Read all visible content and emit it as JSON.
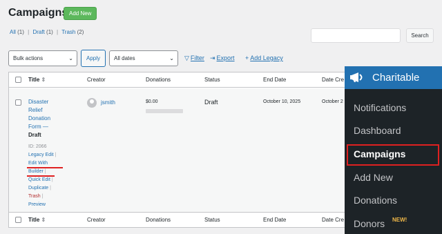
{
  "header": {
    "title": "Campaigns",
    "add_new": "Add New"
  },
  "filters": {
    "all": "All",
    "all_count": "(1)",
    "draft": "Draft",
    "draft_count": "(1)",
    "trash": "Trash",
    "trash_count": "(2)",
    "separator": "|"
  },
  "search": {
    "placeholder": "",
    "button": "Search"
  },
  "toolbar": {
    "bulk_actions": "Bulk actions",
    "apply": "Apply",
    "all_dates": "All dates",
    "filter": "Filter",
    "export": "Export",
    "add_legacy": "Add Legacy"
  },
  "table": {
    "columns": [
      "Title",
      "Creator",
      "Donations",
      "Status",
      "End Date",
      "Date Cre"
    ],
    "row": {
      "title": "Disaster Relief Donation Form",
      "title_suffix": " — ",
      "state": "Draft",
      "id": "ID: 2066",
      "actions": [
        "Legacy Edit",
        "Edit With Builder",
        "Quick Edit",
        "Duplicate",
        "Trash",
        "Preview"
      ],
      "creator": "jsmith",
      "donations": "$0.00",
      "donations_progress": 0,
      "status": "Draft",
      "end_date": "October 10, 2025",
      "date_created": "October 2"
    }
  },
  "menu": {
    "brand": "Charitable",
    "items": [
      "Notifications",
      "Dashboard",
      "Campaigns",
      "Add New",
      "Donations",
      "Donors"
    ],
    "active": "Campaigns",
    "badge": "NEW!"
  },
  "colors": {
    "accent": "#2271b1",
    "highlight": "#e02020",
    "add_new_bg": "#5cb85c",
    "menu_bg": "#1d2327"
  }
}
